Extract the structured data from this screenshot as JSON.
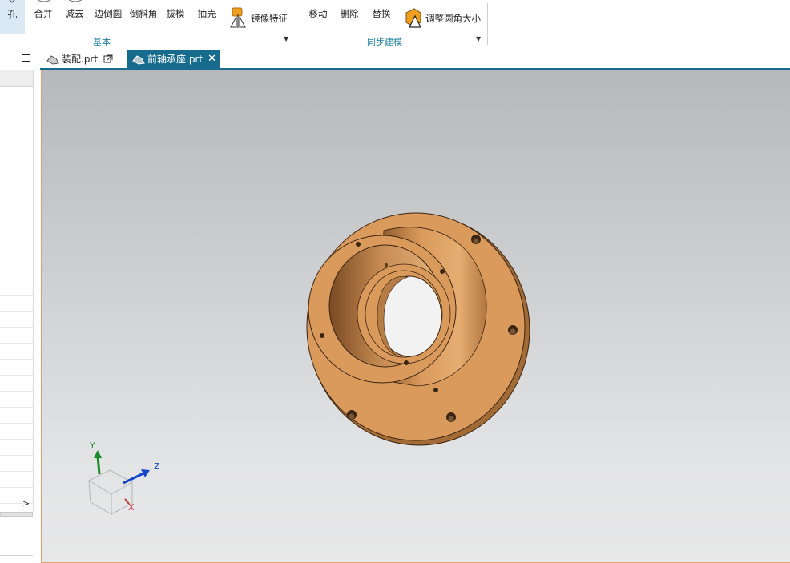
{
  "ribbon": {
    "hole_label": "孔",
    "basic_group": {
      "label": "基本",
      "buttons": [
        {
          "label": "合并",
          "icon": "unite-icon"
        },
        {
          "label": "减去",
          "icon": "subtract-icon"
        },
        {
          "label": "边倒圆",
          "icon": "edge-blend-icon"
        },
        {
          "label": "倒斜角",
          "icon": "chamfer-icon"
        },
        {
          "label": "拔模",
          "icon": "draft-icon"
        },
        {
          "label": "抽壳",
          "icon": "shell-icon"
        }
      ],
      "mirror_label": "镜像特征"
    },
    "sync_group": {
      "label": "同步建模",
      "buttons": [
        {
          "label": "移动",
          "icon": "move-face-icon"
        },
        {
          "label": "删除",
          "icon": "delete-face-icon"
        },
        {
          "label": "替换",
          "icon": "replace-face-icon"
        }
      ],
      "resize_blend_label": "调整圆角大小"
    }
  },
  "tabs": [
    {
      "label": "装配.prt",
      "active": false,
      "icon": "assembly-part-icon"
    },
    {
      "label": "前轴承座.prt",
      "active": true,
      "icon": "part-icon"
    }
  ],
  "viewport": {
    "model_color": "#d99a5b",
    "background_top": "#b6b8bb",
    "background_bottom": "#e8e8e9"
  },
  "triad": {
    "x_label": "X",
    "y_label": "Y",
    "z_label": "Z"
  }
}
